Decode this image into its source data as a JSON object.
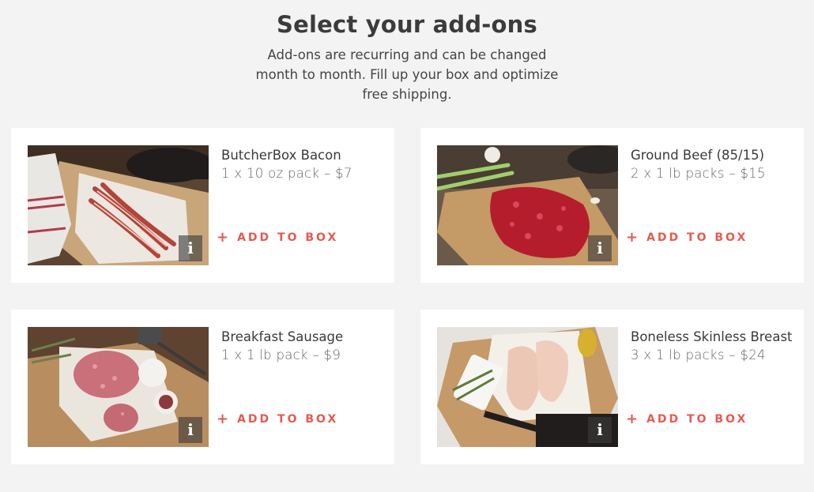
{
  "header": {
    "title": "Select your add-ons",
    "subtitle": "Add-ons are recurring and can be changed month to month. Fill up your box and optimize free shipping."
  },
  "add_label": "ADD TO BOX",
  "info_label": "i",
  "colors": {
    "accent": "#e65a4f",
    "page_bg": "#f3f3f3",
    "card_bg": "#ffffff"
  },
  "products": [
    {
      "name": "ButcherBox Bacon",
      "qty": "1 x 10 oz pack – $7"
    },
    {
      "name": "Ground Beef (85/15)",
      "qty": "2 x 1 lb packs – $15"
    },
    {
      "name": "Breakfast Sausage",
      "qty": "1 x 1 lb pack – $9"
    },
    {
      "name": "Boneless Skinless Breast",
      "qty": "3 x 1 lb packs – $24"
    }
  ]
}
